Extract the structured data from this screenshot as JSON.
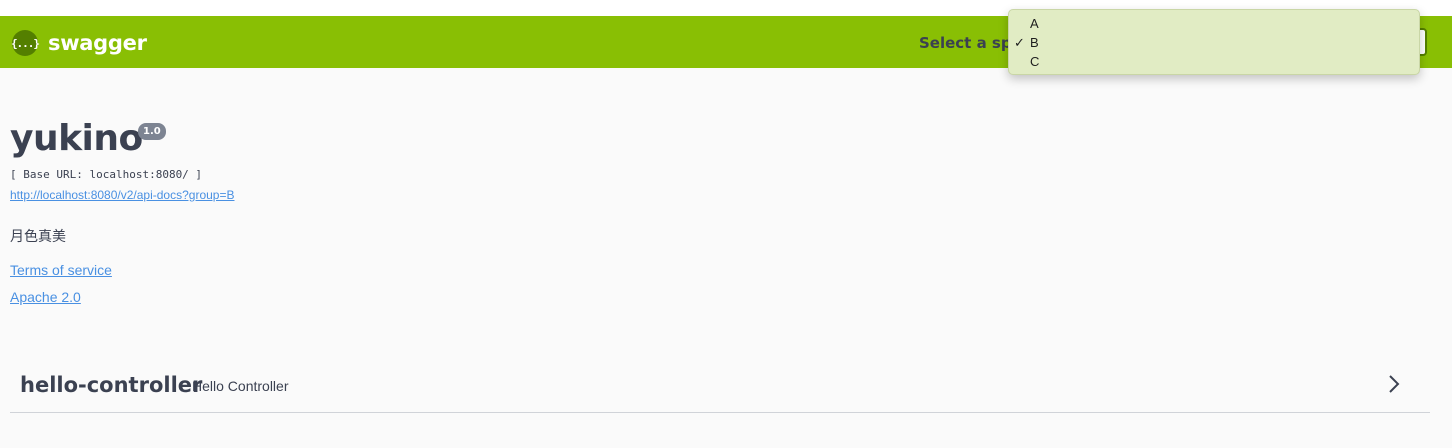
{
  "header": {
    "logo_mark": "{...}",
    "logo_text": "swagger",
    "spec_label": "Select a spec",
    "spec_options": [
      {
        "label": "A",
        "selected": false
      },
      {
        "label": "B",
        "selected": true
      },
      {
        "label": "C",
        "selected": false
      }
    ],
    "check_mark": "✓"
  },
  "info": {
    "title": "yukino",
    "version": "1.0",
    "base_url": "[ Base URL: localhost:8080/ ]",
    "api_docs_url": "http://localhost:8080/v2/api-docs?group=B",
    "description": "月色真美",
    "terms_of_service": "Terms of service",
    "license": "Apache 2.0"
  },
  "tags": [
    {
      "name": "hello-controller",
      "description": "Hello Controller"
    }
  ],
  "colors": {
    "topbar": "#89bf04",
    "link": "#4990e2",
    "text": "#3b4151"
  },
  "icons": [
    "swagger-logo-icon",
    "checkmark-icon",
    "chevron-right-icon"
  ]
}
